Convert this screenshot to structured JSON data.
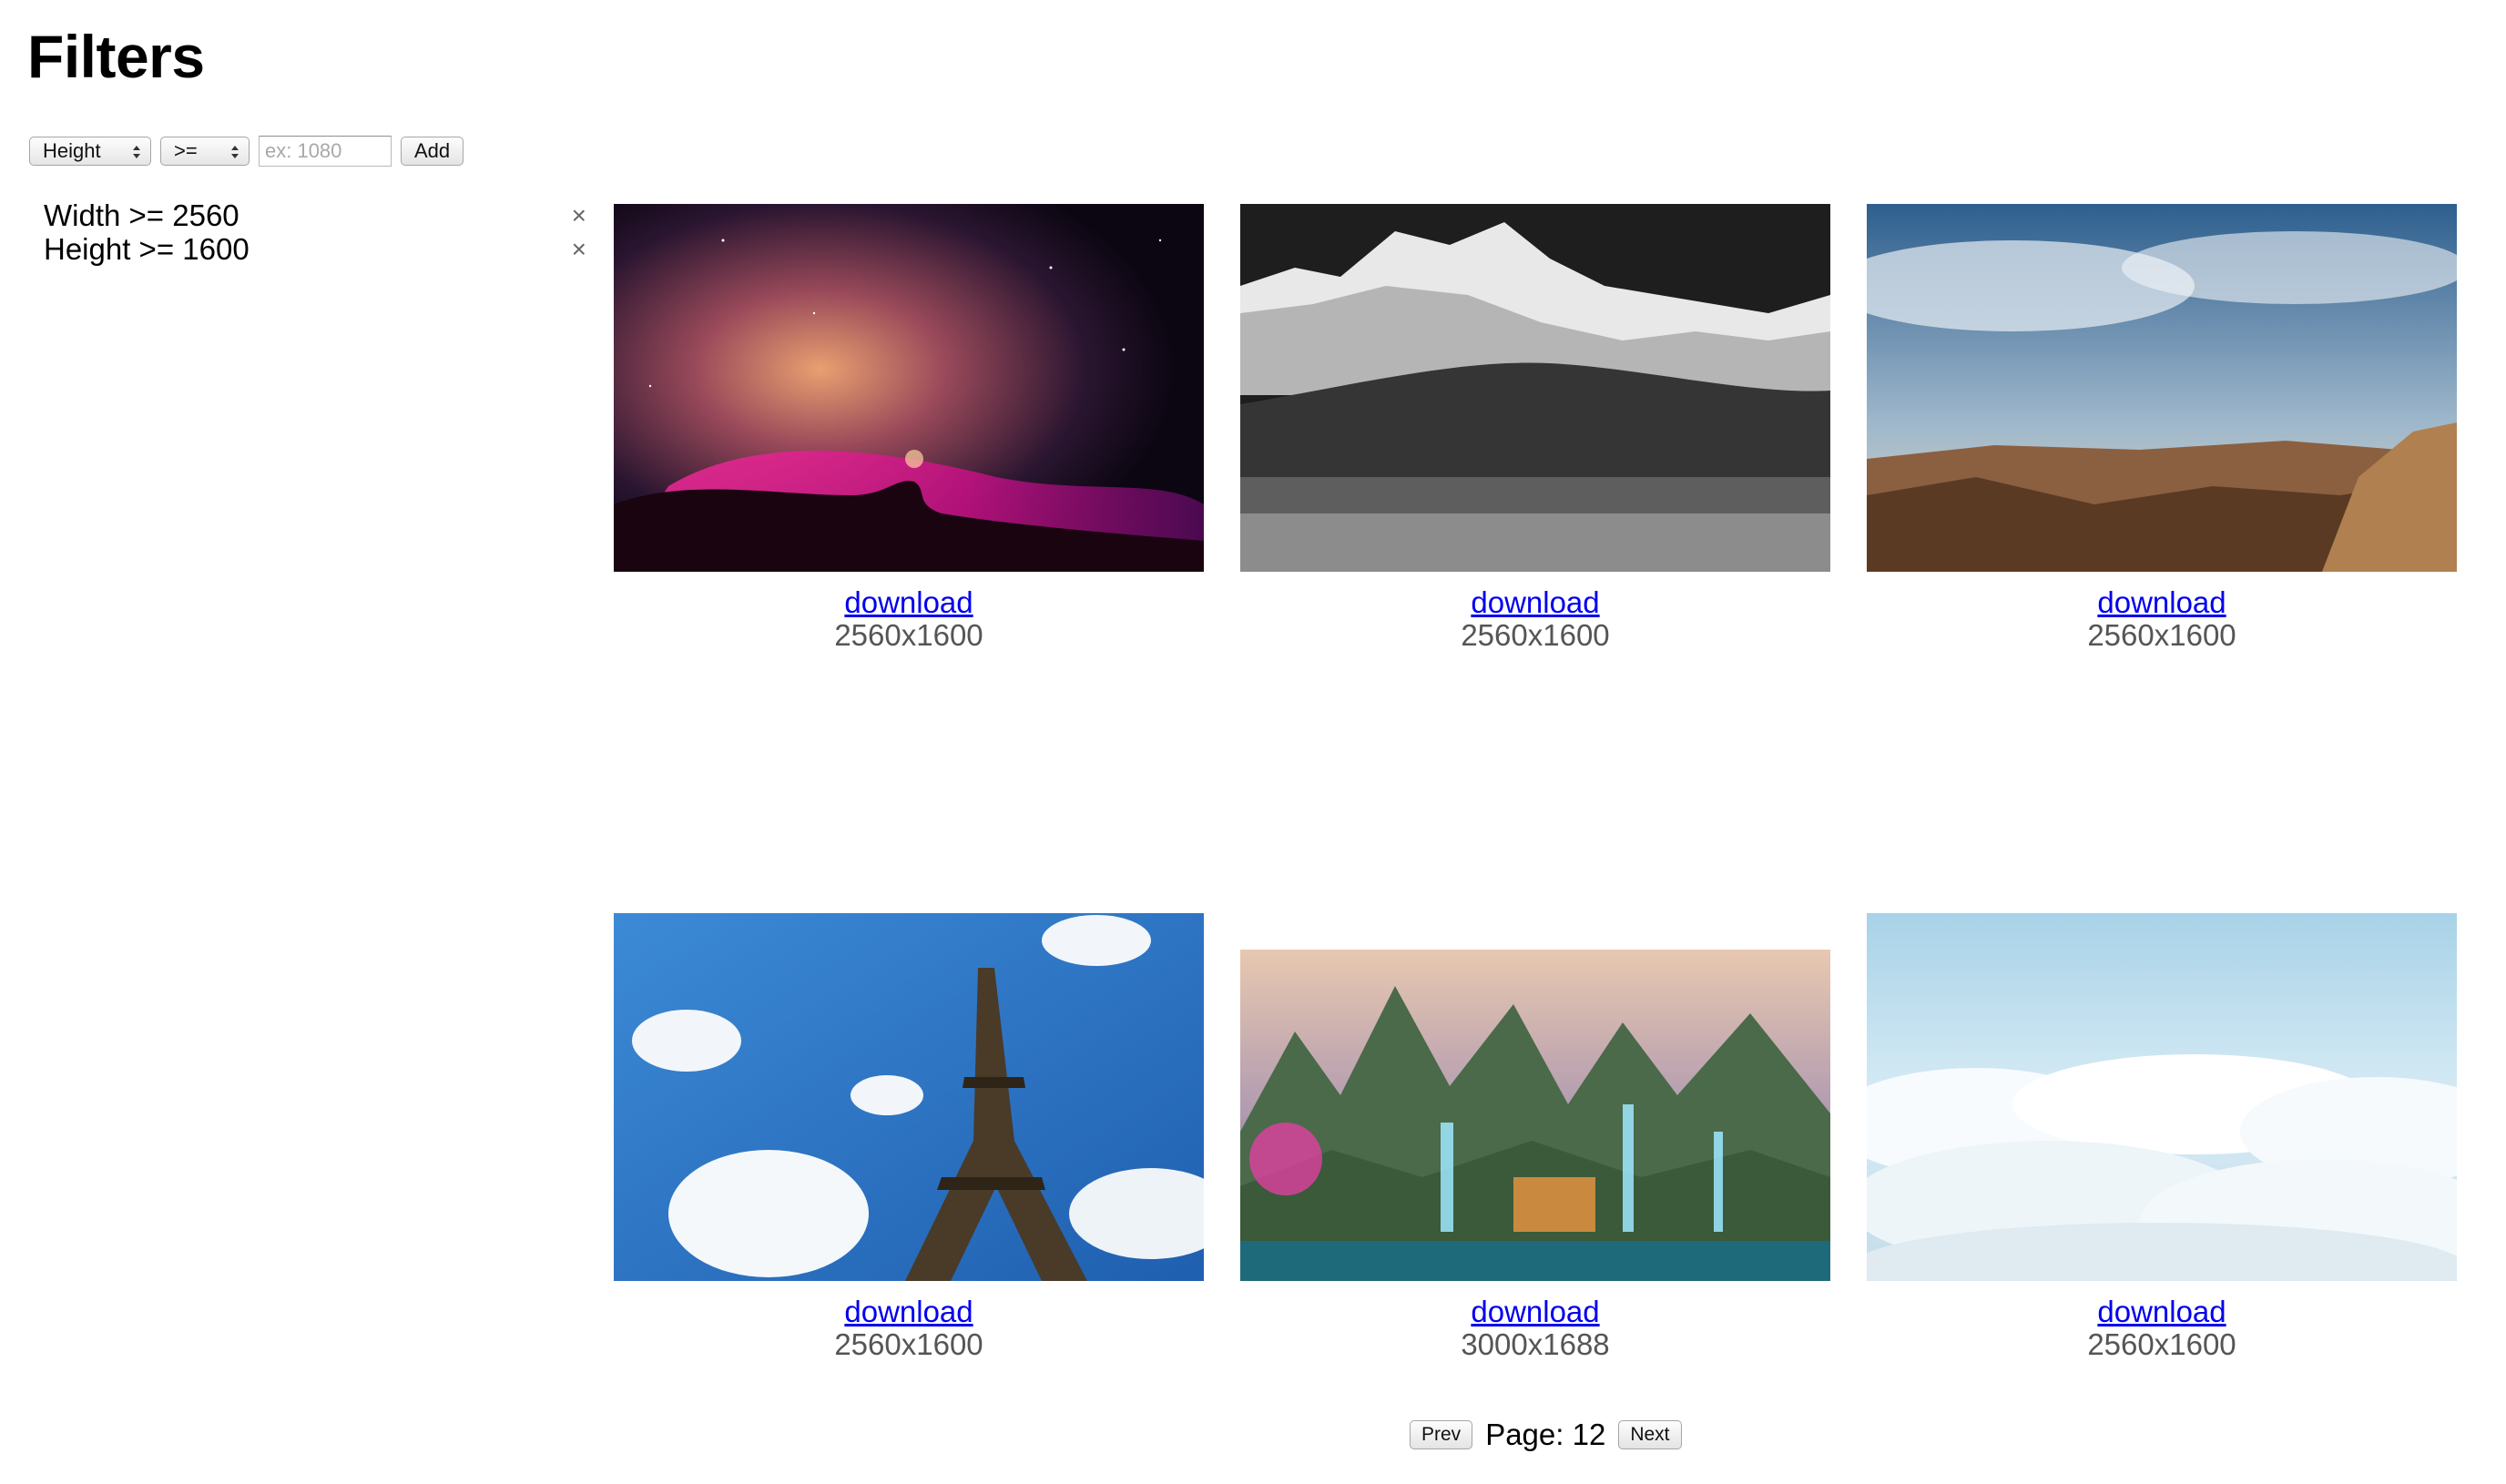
{
  "header": {
    "title": "Filters"
  },
  "filter_form": {
    "field_selected": "Height",
    "operator_selected": ">=",
    "value": "",
    "value_placeholder": "ex: 1080",
    "add_label": "Add"
  },
  "active_filters": [
    {
      "label": "Width >= 2560",
      "remove_icon": "×"
    },
    {
      "label": "Height >= 1600",
      "remove_icon": "×"
    }
  ],
  "wallpapers": [
    {
      "subject": "nebula",
      "link_label": "download",
      "resolution": "2560x1600"
    },
    {
      "subject": "snowy-mountains-bw",
      "link_label": "download",
      "resolution": "2560x1600"
    },
    {
      "subject": "canyon-sky",
      "link_label": "download",
      "resolution": "2560x1600"
    },
    {
      "subject": "eiffel-tower",
      "link_label": "download",
      "resolution": "2560x1600"
    },
    {
      "subject": "fantasy-waterfalls",
      "link_label": "download",
      "resolution": "3000x1688"
    },
    {
      "subject": "clouds",
      "link_label": "download",
      "resolution": "2560x1600"
    }
  ],
  "pagination": {
    "prev_label": "Prev",
    "page_label": "Page: 12",
    "next_label": "Next"
  },
  "colors": {
    "link": "#0000ee",
    "dims_text": "#555555",
    "remove_icon": "#666666"
  }
}
